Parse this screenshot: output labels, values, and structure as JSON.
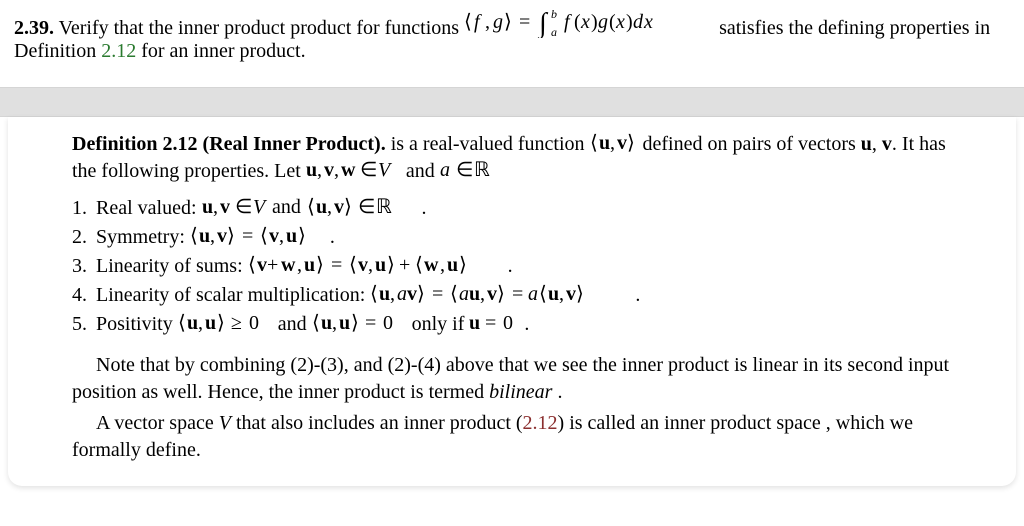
{
  "problem": {
    "number": "2.39.",
    "text_before_ref": " Verify that the inner product product for functions ",
    "text_mid": " satisfies the defining properties in Definition ",
    "ref": "2.12",
    "text_after_ref": " for an inner product."
  },
  "definition": {
    "heading": "Definition 2.12 (Real Inner Product).",
    "lead_before": " is a real-valued function ",
    "lead_after": " defined on pairs of vectors ",
    "lead_vectors": "u",
    "lead_comma": ", ",
    "lead_vectors2": "v",
    "lead_tail": ". It has the following properties. Let ",
    "lead_cond_tail": " and ",
    "properties": [
      {
        "label": "Real valued: ",
        "tail": " ."
      },
      {
        "label": "Symmetry: ",
        "tail": "."
      },
      {
        "label": "Linearity of sums: ",
        "tail": "."
      },
      {
        "label": "Linearity of scalar multiplication: ",
        "tail": " ."
      },
      {
        "label": "Positivity ",
        "mid": " and ",
        "mid2": " only if ",
        "tail": "."
      }
    ],
    "note1_a": "Note that by combining (2)-(3), and (2)-(4) above that we see the inner product is linear in its second input position as well. Hence, the inner product is termed  ",
    "note1_b": "bilinear",
    "note1_c": " .",
    "note2_a": "A vector space ",
    "note2_V": "V",
    "note2_b": " that also includes an inner product (",
    "note2_ref": "2.12",
    "note2_c": ") is called an inner product space , which we formally define."
  }
}
